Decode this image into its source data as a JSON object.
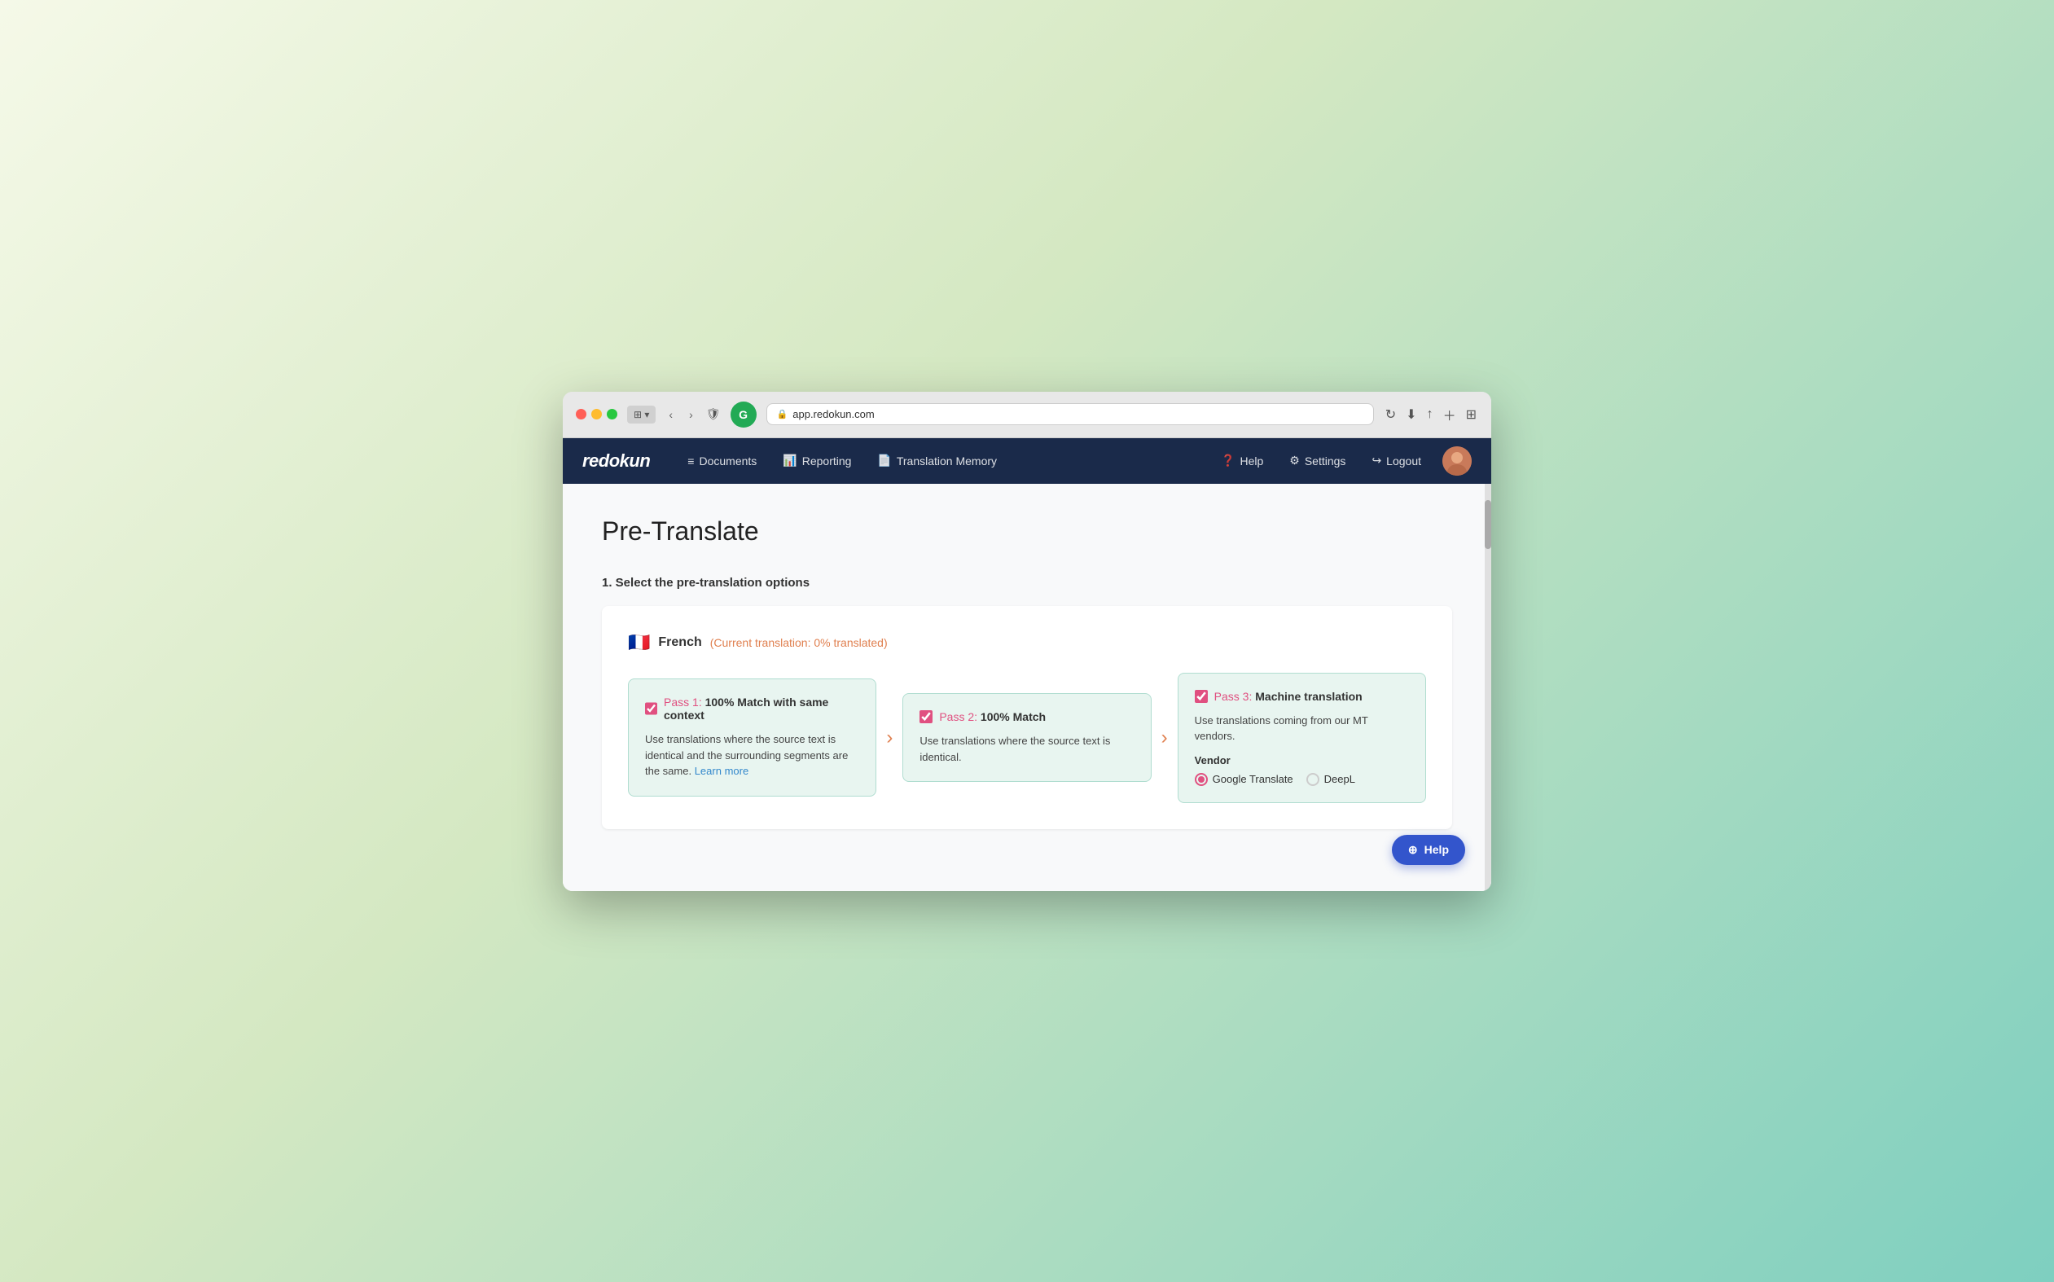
{
  "browser": {
    "url": "app.redokun.com",
    "back_btn": "‹",
    "forward_btn": "›"
  },
  "nav": {
    "logo": "redokun",
    "items": [
      {
        "id": "documents",
        "label": "Documents",
        "icon": "≡"
      },
      {
        "id": "reporting",
        "label": "Reporting",
        "icon": "📊"
      },
      {
        "id": "translation-memory",
        "label": "Translation Memory",
        "icon": "📄"
      }
    ],
    "right_items": [
      {
        "id": "help",
        "label": "Help",
        "icon": "?"
      },
      {
        "id": "settings",
        "label": "Settings",
        "icon": "⚙"
      },
      {
        "id": "logout",
        "label": "Logout",
        "icon": "↪"
      }
    ]
  },
  "page": {
    "title": "Pre-Translate",
    "section_header": "1. Select the pre-translation options",
    "language": {
      "flag": "🇫🇷",
      "name": "French",
      "status": "(Current translation: 0% translated)"
    },
    "passes": [
      {
        "id": "pass1",
        "checked": true,
        "label_prefix": "Pass 1: ",
        "label_strong": "100% Match with same context",
        "description": "Use translations where the source text is identical and the surrounding segments are the same.",
        "link_text": "Learn more",
        "link_href": "#"
      },
      {
        "id": "pass2",
        "checked": true,
        "label_prefix": "Pass 2: ",
        "label_strong": "100% Match",
        "description": "Use translations where the source text is identical.",
        "link_text": null
      },
      {
        "id": "pass3",
        "checked": true,
        "label_prefix": "Pass 3: ",
        "label_strong": "Machine translation",
        "description": "Use translations coming from our MT vendors.",
        "vendor_label": "Vendor",
        "vendors": [
          {
            "id": "google",
            "label": "Google Translate",
            "checked": true
          },
          {
            "id": "deepl",
            "label": "DeepL",
            "checked": false
          }
        ]
      }
    ],
    "help_button": "Help"
  }
}
